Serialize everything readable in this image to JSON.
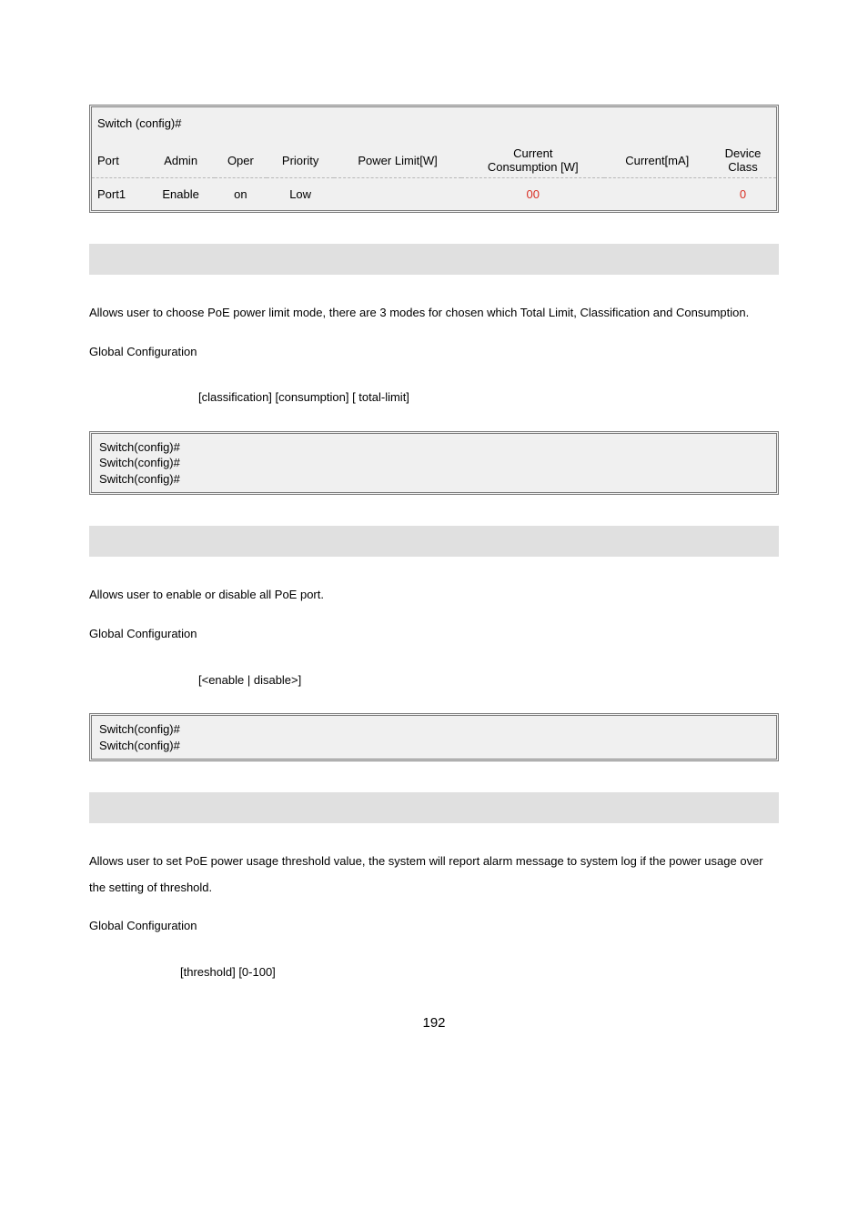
{
  "table": {
    "prompt": "Switch (config)#",
    "headers": {
      "port": "Port",
      "admin": "Admin",
      "oper": "Oper",
      "priority": "Priority",
      "power_limit": "Power Limit[W]",
      "current_consumption_l1": "Current",
      "current_consumption_l2": "Consumption [W]",
      "current_ma": "Current[mA]",
      "device_class_l1": "Device",
      "device_class_l2": "Class"
    },
    "row": {
      "port": "Port1",
      "admin": "Enable",
      "oper": "on",
      "priority": "Low",
      "power_limit": "",
      "current_consumption": "00",
      "current_ma": "",
      "device_class": "0"
    }
  },
  "sections": [
    {
      "desc": "Allows user to choose PoE power limit mode, there are 3 modes for chosen which Total Limit, Classification and Consumption.",
      "mode": "Global Configuration",
      "syntax": "[classification] [consumption] [ total-limit]",
      "example": [
        "Switch(config)#",
        "Switch(config)#",
        "Switch(config)#"
      ]
    },
    {
      "desc": "Allows user to enable or disable all PoE port.",
      "mode": "Global Configuration",
      "syntax": "[<enable | disable>]",
      "example": [
        "Switch(config)#",
        "Switch(config)#"
      ]
    },
    {
      "desc": "Allows user to set PoE power usage threshold value, the system will report alarm message to system log if the power usage over the setting of threshold.",
      "mode": "Global Configuration",
      "syntax": "[threshold] [0-100]",
      "example": null
    }
  ],
  "page_number": "192"
}
